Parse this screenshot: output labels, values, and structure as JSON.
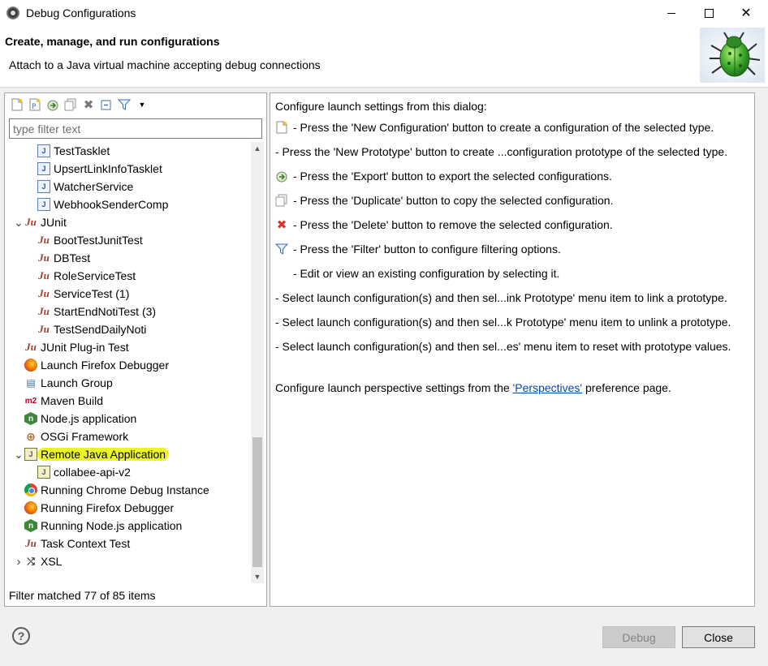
{
  "window": {
    "title": "Debug Configurations",
    "minimize_label": "—",
    "maximize_label": "",
    "close_label": "✕"
  },
  "header": {
    "title": "Create, manage, and run configurations",
    "subtitle": "Attach to a Java virtual machine accepting debug connections"
  },
  "left": {
    "filter": {
      "value": "",
      "placeholder": "type filter text"
    },
    "tree": [
      {
        "label": "TestTasklet",
        "level": 2,
        "icon": "java-app-icon"
      },
      {
        "label": "UpsertLinkInfoTasklet",
        "level": 2,
        "icon": "java-app-icon"
      },
      {
        "label": "WatcherService",
        "level": 2,
        "icon": "java-app-icon"
      },
      {
        "label": "WebhookSenderComp",
        "level": 2,
        "icon": "java-app-icon"
      },
      {
        "label": "JUnit",
        "level": 1,
        "icon": "junit-icon",
        "expanded": true
      },
      {
        "label": "BootTestJunitTest",
        "level": 2,
        "icon": "junit-icon"
      },
      {
        "label": "DBTest",
        "level": 2,
        "icon": "junit-icon"
      },
      {
        "label": "RoleServiceTest",
        "level": 2,
        "icon": "junit-icon"
      },
      {
        "label": "ServiceTest (1)",
        "level": 2,
        "icon": "junit-icon"
      },
      {
        "label": "StartEndNotiTest (3)",
        "level": 2,
        "icon": "junit-icon"
      },
      {
        "label": "TestSendDailyNoti",
        "level": 2,
        "icon": "junit-icon"
      },
      {
        "label": "JUnit Plug-in Test",
        "level": 1,
        "icon": "junit-plugin-icon"
      },
      {
        "label": "Launch Firefox Debugger",
        "level": 1,
        "icon": "firefox-icon"
      },
      {
        "label": "Launch Group",
        "level": 1,
        "icon": "launch-group-icon"
      },
      {
        "label": "Maven Build",
        "level": 1,
        "icon": "maven-icon"
      },
      {
        "label": "Node.js application",
        "level": 1,
        "icon": "nodejs-icon"
      },
      {
        "label": "OSGi Framework",
        "level": 1,
        "icon": "osgi-icon"
      },
      {
        "label": "Remote Java Application",
        "level": 1,
        "icon": "remote-java-icon",
        "expanded": true,
        "highlighted": true
      },
      {
        "label": "collabee-api-v2",
        "level": 2,
        "icon": "remote-java-icon"
      },
      {
        "label": "Running Chrome Debug Instance",
        "level": 1,
        "icon": "chrome-icon"
      },
      {
        "label": "Running Firefox Debugger",
        "level": 1,
        "icon": "firefox-icon"
      },
      {
        "label": "Running Node.js application",
        "level": 1,
        "icon": "nodejs-icon"
      },
      {
        "label": "Task Context Test",
        "level": 1,
        "icon": "junit-plugin-icon"
      },
      {
        "label": "XSL",
        "level": 1,
        "icon": "xsl-icon",
        "collapsed": true
      }
    ],
    "status": "Filter matched 77 of 85 items"
  },
  "right": {
    "intro": "Configure launch settings from this dialog:",
    "lines": [
      {
        "icon": "new-config-icon",
        "text": "- Press the 'New Configuration' button to create a configuration of the selected type."
      },
      {
        "icon": "",
        "text": "- Press the 'New Prototype' button to create ...configuration prototype of the selected type."
      },
      {
        "icon": "export-icon",
        "text": "- Press the 'Export' button to export the selected configurations."
      },
      {
        "icon": "duplicate-icon",
        "text": "- Press the 'Duplicate' button to copy the selected configuration."
      },
      {
        "icon": "delete-icon",
        "text": "- Press the 'Delete' button to remove the selected configuration."
      },
      {
        "icon": "filter-icon",
        "text": "- Press the 'Filter' button to configure filtering options."
      },
      {
        "icon": "",
        "text": "- Edit or view an existing configuration by selecting it."
      },
      {
        "icon": "",
        "text": "- Select launch configuration(s) and then sel...ink Prototype' menu item to link a prototype."
      },
      {
        "icon": "",
        "text": "- Select launch configuration(s) and then sel...k Prototype' menu item to unlink a prototype."
      },
      {
        "icon": "",
        "text": "- Select launch configuration(s) and then sel...es' menu item to reset with prototype values."
      }
    ],
    "perspective_prefix": "Configure launch perspective settings from the ",
    "perspective_link": "'Perspectives'",
    "perspective_suffix": " preference page."
  },
  "footer": {
    "help_label": "?",
    "debug_label": "Debug",
    "close_label": "Close"
  }
}
